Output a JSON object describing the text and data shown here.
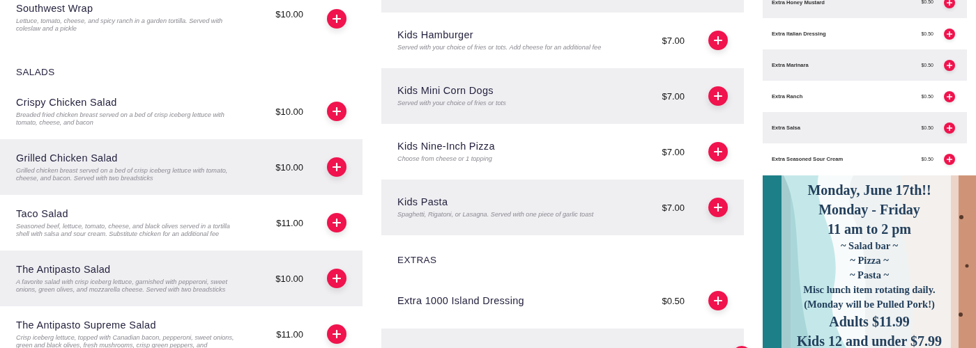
{
  "columns": [
    {
      "entries": [
        {
          "kind": "item",
          "shaded": false,
          "name": "Southwest Wrap",
          "description": "Lettuce, tomato, cheese, and spicy ranch in a garden tortilla. Served with coleslaw and a pickle",
          "price": "$10.00"
        },
        {
          "kind": "heading",
          "text": "SALADS"
        },
        {
          "kind": "item",
          "shaded": false,
          "name": "Crispy Chicken Salad",
          "description": "Breaded fried chicken breast served on a bed of crisp iceberg lettuce with tomato, cheese, and bacon",
          "price": "$10.00"
        },
        {
          "kind": "item",
          "shaded": true,
          "name": "Grilled Chicken Salad",
          "description": "Grilled chicken breast served on a bed of crisp iceberg lettuce with tomato, cheese, and bacon. Served with two breadsticks",
          "price": "$10.00"
        },
        {
          "kind": "item",
          "shaded": false,
          "name": "Taco Salad",
          "description": "Seasoned beef, lettuce, tomato, cheese, and black olives served in a tortilla shell with salsa and sour cream. Substitute chicken for an additional fee",
          "price": "$11.00"
        },
        {
          "kind": "item",
          "shaded": true,
          "name": "The Antipasto Salad",
          "description": "A favorite salad with crisp iceberg lettuce, garnished with pepperoni, sweet onions, green olives, and mozzarella cheese.  Served with two breadsticks",
          "price": "$10.00"
        },
        {
          "kind": "item",
          "shaded": false,
          "name": "The Antipasto Supreme Salad",
          "description": "Crisp iceberg lettuce, topped with Canadian bacon, pepperoni, sweet onions, green and black olives, fresh mushrooms, crisp green peppers, and",
          "price": "$11.00"
        }
      ]
    },
    {
      "entries": [
        {
          "kind": "cut_row",
          "shaded": true
        },
        {
          "kind": "item",
          "shaded": false,
          "name": "Kids Hamburger",
          "description": "Served with your choice of fries or tots. Add cheese for an additional fee",
          "price": "$7.00"
        },
        {
          "kind": "item",
          "shaded": true,
          "name": "Kids Mini Corn Dogs",
          "description": "Served with your choice of fries or tots",
          "price": "$7.00"
        },
        {
          "kind": "item",
          "shaded": false,
          "name": "Kids Nine-Inch Pizza",
          "description": "Choose from cheese or 1 topping",
          "price": "$7.00"
        },
        {
          "kind": "item",
          "shaded": true,
          "name": "Kids Pasta",
          "description": "Spaghetti, Rigatoni, or Lasagna. Served with one piece of garlic toast",
          "price": "$7.00"
        },
        {
          "kind": "heading",
          "text": "EXTRAS"
        },
        {
          "kind": "item",
          "shaded": false,
          "name": "Extra 1000 Island Dressing",
          "price": "$0.50"
        },
        {
          "kind": "cut_row",
          "shaded": true
        }
      ]
    }
  ],
  "side_menu": {
    "items": [
      {
        "name": "Extra Honey Mustard",
        "price": "$0.50",
        "shaded": true
      },
      {
        "name": "Extra Italian Dressing",
        "price": "$0.50",
        "shaded": false
      },
      {
        "name": "Extra Marinara",
        "price": "$0.50",
        "shaded": true
      },
      {
        "name": "Extra Ranch",
        "price": "$0.50",
        "shaded": false
      },
      {
        "name": "Extra Salsa",
        "price": "$0.50",
        "shaded": true
      },
      {
        "name": "Extra Seasoned Sour Cream",
        "price": "$0.50",
        "shaded": false
      }
    ]
  },
  "flyer": {
    "kind": "picture",
    "lines": [
      {
        "kind": "heading",
        "text": "Monday, June 17th!!"
      },
      {
        "kind": "heading",
        "text": "Monday - Friday"
      },
      {
        "kind": "heading",
        "text": "11 am to 2 pm"
      },
      {
        "kind": "body",
        "text": "~ Salad bar ~"
      },
      {
        "kind": "body",
        "text": "~ Pizza ~"
      },
      {
        "kind": "body",
        "text": "~ Pasta ~"
      },
      {
        "kind": "body",
        "text": "Misc lunch item rotating daily."
      },
      {
        "kind": "body",
        "text": "(Monday will be Pulled Pork!)"
      },
      {
        "kind": "heading",
        "text": "Adults $11.99"
      },
      {
        "kind": "heading",
        "text": "Kids 12 and under $7.99"
      }
    ]
  }
}
